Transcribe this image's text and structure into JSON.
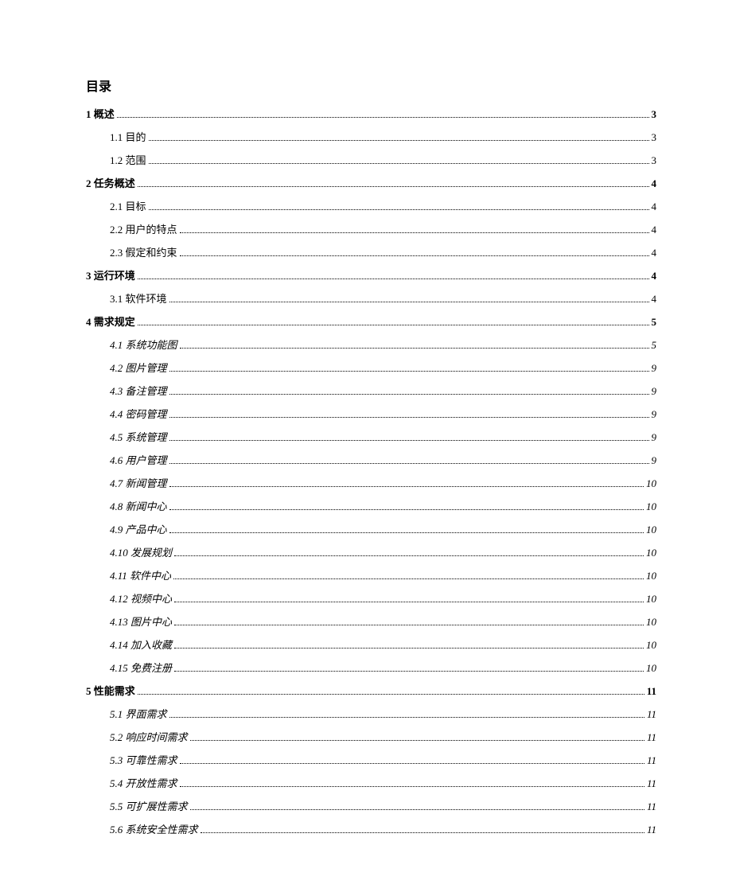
{
  "title": "目录",
  "entries": [
    {
      "indent": "l1",
      "style": "bold",
      "label": "1 概述",
      "page": "3"
    },
    {
      "indent": "l2",
      "style": "normal",
      "label": "1.1 目的",
      "page": "3"
    },
    {
      "indent": "l2",
      "style": "normal",
      "label": "1.2 范围",
      "page": "3"
    },
    {
      "indent": "l1",
      "style": "bold",
      "label": "2 任务概述",
      "page": "4"
    },
    {
      "indent": "l2",
      "style": "normal",
      "label": "2.1 目标",
      "page": "4"
    },
    {
      "indent": "l2",
      "style": "normal",
      "label": "2.2 用户的特点",
      "page": "4"
    },
    {
      "indent": "l2",
      "style": "normal",
      "label": "2.3 假定和约束",
      "page": "4"
    },
    {
      "indent": "l1",
      "style": "bold",
      "label": "3 运行环境",
      "page": "4"
    },
    {
      "indent": "l2",
      "style": "normal",
      "label": "3.1 软件环境",
      "page": "4"
    },
    {
      "indent": "l1",
      "style": "bold",
      "label": "4 需求规定",
      "page": "5"
    },
    {
      "indent": "l2",
      "style": "italic",
      "label": "4.1 系统功能图",
      "page": "5"
    },
    {
      "indent": "l2",
      "style": "italic",
      "label": "4.2 图片管理",
      "page": "9"
    },
    {
      "indent": "l2",
      "style": "italic",
      "label": "4.3 备注管理",
      "page": "9"
    },
    {
      "indent": "l2",
      "style": "italic",
      "label": "4.4 密码管理",
      "page": "9"
    },
    {
      "indent": "l2",
      "style": "italic",
      "label": "4.5 系统管理",
      "page": "9"
    },
    {
      "indent": "l2",
      "style": "italic",
      "label": "4.6 用户管理",
      "page": "9"
    },
    {
      "indent": "l2",
      "style": "italic",
      "label": "4.7 新闻管理",
      "page": "10"
    },
    {
      "indent": "l2",
      "style": "italic",
      "label": "4.8 新闻中心",
      "page": "10"
    },
    {
      "indent": "l2",
      "style": "italic",
      "label": "4.9 产品中心",
      "page": "10"
    },
    {
      "indent": "l2",
      "style": "italic",
      "label": "4.10 发展规划",
      "page": "10"
    },
    {
      "indent": "l2",
      "style": "italic",
      "label": "4.11 软件中心",
      "page": "10"
    },
    {
      "indent": "l2",
      "style": "italic",
      "label": "4.12 视频中心",
      "page": "10"
    },
    {
      "indent": "l2",
      "style": "italic",
      "label": "4.13 图片中心",
      "page": "10"
    },
    {
      "indent": "l2",
      "style": "italic",
      "label": "4.14 加入收藏",
      "page": "10"
    },
    {
      "indent": "l2",
      "style": "italic",
      "label": "4.15 免费注册",
      "page": "10"
    },
    {
      "indent": "l1",
      "style": "bold",
      "label": "5 性能需求",
      "page": "11"
    },
    {
      "indent": "l2",
      "style": "italic",
      "label": "5.1 界面需求",
      "page": "11"
    },
    {
      "indent": "l2",
      "style": "italic",
      "label": "5.2 响应时间需求",
      "page": "11"
    },
    {
      "indent": "l2",
      "style": "italic",
      "label": "5.3 可靠性需求",
      "page": "11"
    },
    {
      "indent": "l2",
      "style": "italic",
      "label": "5.4 开放性需求",
      "page": "11"
    },
    {
      "indent": "l2",
      "style": "italic",
      "label": "5.5 可扩展性需求",
      "page": "11"
    },
    {
      "indent": "l2",
      "style": "italic",
      "label": "5.6 系统安全性需求",
      "page": "11"
    }
  ]
}
